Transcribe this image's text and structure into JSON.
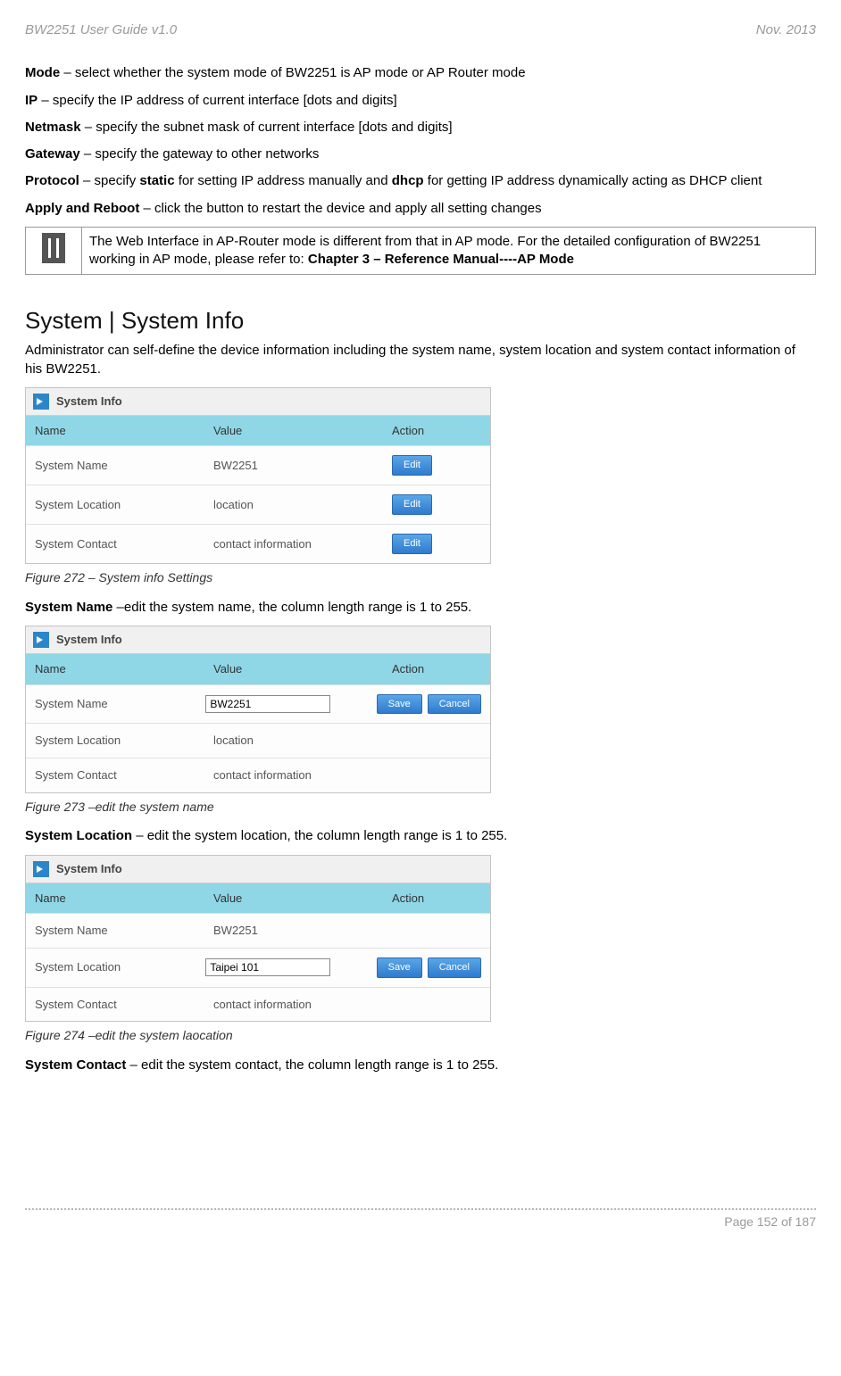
{
  "header": {
    "left": "BW2251 User Guide v1.0",
    "right": "Nov.  2013"
  },
  "defs": {
    "mode": {
      "term": "Mode",
      "text": " – select whether the system mode of BW2251 is AP mode or AP Router mode"
    },
    "ip": {
      "term": "IP",
      "text": " – specify the IP address of current interface [dots and digits]"
    },
    "netmask": {
      "term": "Netmask",
      "text": " – specify the subnet mask of current interface [dots and digits]"
    },
    "gateway": {
      "term": "Gateway",
      "text": " – specify the gateway to other networks"
    },
    "protocol": {
      "term": "Protocol",
      "t1": " – specify ",
      "b1": "static",
      "t2": " for setting IP address manually and ",
      "b2": "dhcp",
      "t3": " for getting IP address dynamically acting as DHCP client"
    },
    "apply": {
      "term": "Apply and Reboot",
      "text": " – click the button to restart the device and apply all setting changes"
    }
  },
  "note": {
    "t1": "The Web Interface in AP-Router mode is different from that in AP mode. For the detailed configuration of BW2251 working in AP mode, please refer to:  ",
    "b1": "Chapter 3 – Reference Manual----AP Mode"
  },
  "section_title": "System | System Info",
  "section_intro": "Administrator can self-define the device information including the system name, system location and system contact information of his BW2251.",
  "fig_header": {
    "title": "System Info",
    "col_name": "Name",
    "col_value": "Value",
    "col_action": "Action"
  },
  "rows": {
    "name_label": "System Name",
    "location_label": "System Location",
    "contact_label": "System Contact",
    "name_value": "BW2251",
    "location_value": "location",
    "contact_value": "contact information",
    "location_value_edit": "Taipei 101"
  },
  "buttons": {
    "edit": "Edit",
    "save": "Save",
    "cancel": "Cancel"
  },
  "captions": {
    "f272": "Figure 272 – System info Settings",
    "f273": "Figure 273 –edit the system name",
    "f274": "Figure 274 –edit the system laocation"
  },
  "texts": {
    "sys_name": {
      "term": "System Name",
      "text": " –edit the system name, the column length range is 1 to 255."
    },
    "sys_loc": {
      "term": "System Location",
      "text": " – edit the system location, the column length range is 1 to 255."
    },
    "sys_contact": {
      "term": "System Contact",
      "text": " – edit the system contact, the column length range is 1 to 255."
    }
  },
  "footer": "Page 152 of 187"
}
